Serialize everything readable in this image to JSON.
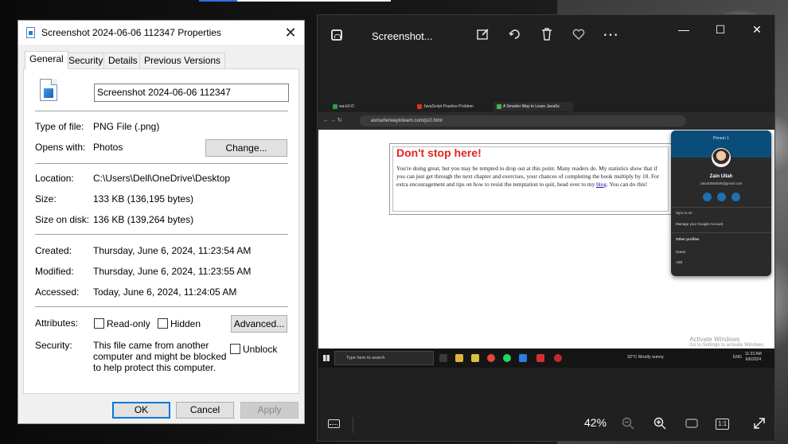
{
  "dialog": {
    "title": "Screenshot 2024-06-06 112347 Properties",
    "close": "✕",
    "tabs": [
      "General",
      "Security",
      "Details",
      "Previous Versions"
    ],
    "filename": "Screenshot 2024-06-06 112347",
    "type_label": "Type of file:",
    "type_value": "PNG File (.png)",
    "opens_label": "Opens with:",
    "opens_value": "Photos",
    "change_button": "Change...",
    "location_label": "Location:",
    "location_value": "C:\\Users\\Dell\\OneDrive\\Desktop",
    "size_label": "Size:",
    "size_value": "133 KB (136,195 bytes)",
    "size_disk_label": "Size on disk:",
    "size_disk_value": "136 KB (139,264 bytes)",
    "created_label": "Created:",
    "created_value": "Thursday, June 6, 2024, 11:23:54 AM",
    "modified_label": "Modified:",
    "modified_value": "Thursday, June 6, 2024, 11:23:55 AM",
    "accessed_label": "Accessed:",
    "accessed_value": "Today, June 6, 2024, 11:24:05 AM",
    "attributes_label": "Attributes:",
    "readonly_label": "Read-only",
    "hidden_label": "Hidden",
    "advanced_button": "Advanced...",
    "security_label": "Security:",
    "security_text": "This file came from another computer and might be blocked to help protect this computer.",
    "unblock_label": "Unblock",
    "ok_button": "OK",
    "cancel_button": "Cancel",
    "apply_button": "Apply"
  },
  "viewer": {
    "title": "Screenshot...",
    "minimize": "—",
    "maximize": "☐",
    "close": "✕",
    "zoom": "42%",
    "one_to_one": "1:1",
    "icons": {
      "gallery": "gallery-icon",
      "edit": "edit-icon",
      "rotate": "rotate-icon",
      "delete": "delete-icon",
      "favorite": "heart-icon",
      "more": "more-icon",
      "filmstrip": "filmstrip-icon",
      "zoom_out": "zoom-out-icon",
      "zoom_in": "zoom-in-icon",
      "fit": "fit-icon",
      "fullscreen": "fullscreen-icon"
    },
    "screenshot": {
      "tabs": [
        "wa-b2-D",
        "JavaScript Practice Problem",
        "A Smarter Way to Learn JavaSc"
      ],
      "url": "asmarterwaytolearn.com/js/2.html",
      "heading": "Don't stop here!",
      "paragraph_before_link": "You're doing great, but you may be tempted to drop out at this point. Many readers do. My statistics show that if you can just get through the next chapter and exercises, your chances of completing the book multiply by 10. For extra encouragement and tips on how to resist the temptation to quit, head over to my ",
      "link": "blog",
      "paragraph_after_link": ". You can do this!",
      "profile": {
        "person": "Person 1",
        "name": "Zain Ullah",
        "email": "zain2006ullah@gmail.com",
        "sync": "Sync is on",
        "manage": "Manage your Google Account",
        "other": "Other profiles",
        "guest": "Guest",
        "add": "Add"
      },
      "activate_title": "Activate Windows",
      "activate_sub": "Go to Settings to activate Windows.",
      "taskbar_search": "Type here to search",
      "weather": "32°C  Mostly sunny",
      "lang": "ENG",
      "time": "11:23 AM",
      "date": "6/6/2024"
    }
  },
  "colors": {
    "accent": "#0078d7",
    "heading_red": "#e02424",
    "profile_header": "#0a4c7a"
  }
}
